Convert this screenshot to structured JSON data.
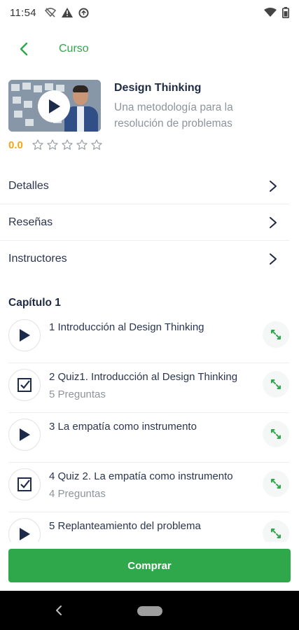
{
  "status_bar": {
    "time": "11:54",
    "icons_left": [
      "wifi-off-icon",
      "alert-icon",
      "data-saver-icon"
    ],
    "icons_right": [
      "signal-icon",
      "battery-icon"
    ]
  },
  "header": {
    "title": "Curso",
    "back_icon": "chevron-left-icon"
  },
  "course": {
    "title": "Design Thinking",
    "subtitle": "Una metodología para la resolución de problemas",
    "rating": "0.0",
    "stars_total": 5,
    "stars_filled": 0
  },
  "menu": {
    "items": [
      {
        "label": "Detalles"
      },
      {
        "label": "Reseñas"
      },
      {
        "label": "Instructores"
      }
    ]
  },
  "chapter": {
    "title": "Capítulo 1",
    "lessons": [
      {
        "type": "video",
        "title": "1 Introducción al Design Thinking",
        "subtitle": ""
      },
      {
        "type": "quiz",
        "title": "2 Quiz1.  Introducción al Design Thinking",
        "subtitle": "5 Preguntas"
      },
      {
        "type": "video",
        "title": "3 La empatía como instrumento",
        "subtitle": ""
      },
      {
        "type": "quiz",
        "title": "4 Quiz 2. La empatía como instrumento",
        "subtitle": "4 Preguntas"
      },
      {
        "type": "video",
        "title": "5 Replanteamiento del problema",
        "subtitle": ""
      }
    ]
  },
  "buy_button": {
    "label": "Comprar"
  },
  "colors": {
    "accent_green": "#2ea84a",
    "rating_orange": "#f2a516",
    "text_dark": "#1f2a44",
    "text_muted": "#8e939c"
  }
}
